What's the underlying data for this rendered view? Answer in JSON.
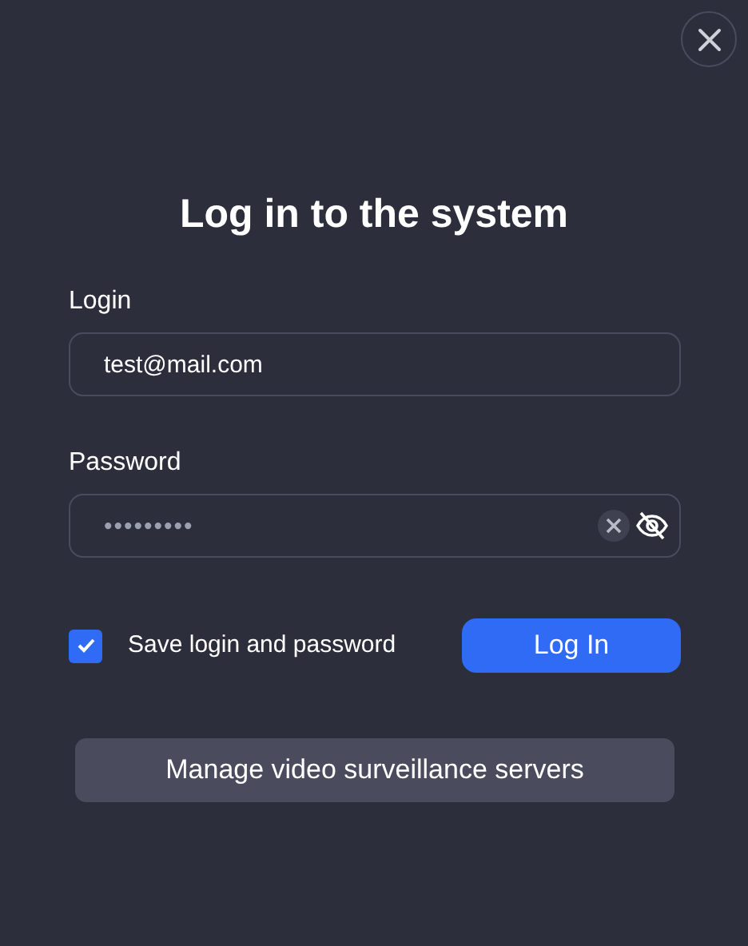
{
  "title": "Log in to the system",
  "login": {
    "label": "Login",
    "value": "test@mail.com"
  },
  "password": {
    "label": "Password",
    "value": "•••••••••"
  },
  "save_credentials": {
    "label": "Save login and password",
    "checked": true
  },
  "login_button": "Log In",
  "manage_button": "Manage video surveillance servers"
}
